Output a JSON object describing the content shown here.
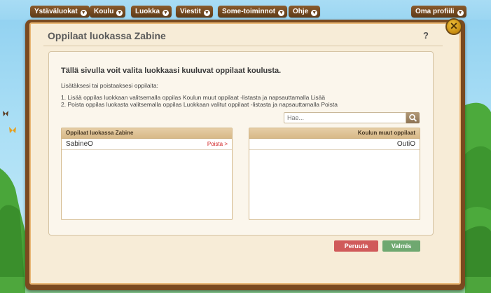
{
  "nav": {
    "items": [
      {
        "label": "Ystäväluokat"
      },
      {
        "label": "Koulu"
      },
      {
        "label": "Luokka"
      },
      {
        "label": "Viestit"
      },
      {
        "label": "Some-toiminnot"
      },
      {
        "label": "Ohje"
      }
    ],
    "profile": {
      "label": "Oma profiili"
    }
  },
  "dialog": {
    "title": "Oppilaat luokassa Zabine",
    "help": "?",
    "close_icon": "close-x-icon",
    "intro": "Tällä sivulla voit valita luokkaasi kuuluvat oppilaat koulusta.",
    "sub": "Lisätäksesi tai poistaaksesi oppilaita:",
    "instructions": [
      "1.  Lisää oppilas luokkaan valitsemalla oppilas Koulun muut oppilaat -listasta ja napsauttamalla Lisää",
      "2.  Poista oppilas luokasta valitsemalla oppilas Luokkaan valitut oppilaat -listasta ja napsauttamalla Poista"
    ],
    "search": {
      "placeholder": "Hae...",
      "icon": "search-icon"
    },
    "class_list": {
      "header": "Oppilaat luokassa Zabine",
      "rows": [
        {
          "name": "SabineO",
          "action": "Poista >"
        }
      ]
    },
    "school_list": {
      "header": "Koulun muut oppilaat",
      "rows": [
        {
          "name": "OutiO"
        }
      ]
    },
    "buttons": {
      "cancel": "Peruuta",
      "done": "Valmis"
    }
  },
  "colors": {
    "frame": "#7a4a20",
    "panel_bg": "#f7ecd7",
    "cancel": "#d05a5a",
    "done": "#6fa870",
    "remove_link": "#d02020"
  }
}
